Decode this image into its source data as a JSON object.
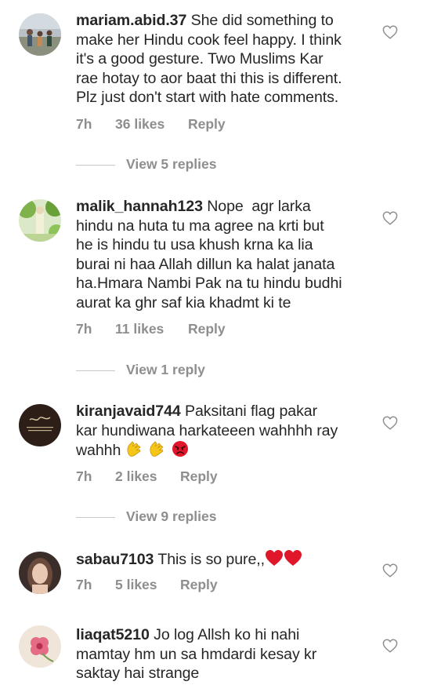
{
  "comments": [
    {
      "username": "mariam.abid.37",
      "text": "She did something to make her Hindu cook feel happy. I think it's a good gesture. Two Muslims Kar rae hotay to aor baat thi this is different. Plz just don't start with hate comments.",
      "lines": [
        "mariam.abid.37 She did something to",
        "make her Hindu cook feel happy. I think",
        "it's a good gesture. Two Muslims Kar",
        "rae hotay to aor baat thi this is different.",
        "Plz just don't start with hate comments."
      ],
      "time": "7h",
      "likes": "36 likes",
      "reply_label": "Reply",
      "view_replies": "View 5 replies",
      "avatar": "family-photo"
    },
    {
      "username": "malik_hannah123",
      "text": "Nope  agr larka hindu na huta tu ma agree na krti but he is hindu tu usa khush krna ka lia burai ni haa Allah dillun ka halat janata ha.Hmara Nambi Pak na tu hindu budhi aurat ka ghr saf kia khadmt ki te",
      "lines": [
        "malik_hannah123 Nope  agr larka",
        "hindu na huta tu ma agree na krti but",
        "he is hindu tu usa khush krna ka lia",
        "burai ni haa Allah dillun ka halat janata",
        "ha.Hmara Nambi Pak na tu hindu budhi",
        "aurat ka ghr saf kia khadmt ki te"
      ],
      "time": "7h",
      "likes": "11 likes",
      "reply_label": "Reply",
      "view_replies": "View 1 reply",
      "avatar": "garden-photo"
    },
    {
      "username": "kiranjavaid744",
      "text": "Paksitani flag pakar kar hundiwana harkateeen wahhhh ray wahhh",
      "lines": [
        "kiranjavaid744 Paksitani flag pakar",
        "kar hundiwana harkateeen wahhhh ray",
        "wahhh"
      ],
      "emojis": [
        "clapping-hands",
        "clapping-hands",
        "angry-face"
      ],
      "time": "7h",
      "likes": "2 likes",
      "reply_label": "Reply",
      "view_replies": "View 9 replies",
      "avatar": "calligraphy-dark"
    },
    {
      "username": "sabau7103",
      "text": "This is so pure,,",
      "lines": [
        "sabau7103 This is so pure,,"
      ],
      "emojis": [
        "red-heart",
        "red-heart"
      ],
      "time": "7h",
      "likes": "5 likes",
      "reply_label": "Reply",
      "avatar": "portrait-photo"
    },
    {
      "username": "liaqat5210",
      "text": "Jo log Allsh ko hi nahi mamtay hm un sa hmdardi kesay kr saktay hai strange",
      "lines": [
        "liaqat5210 Jo log Allsh ko hi nahi",
        "mamtay hm un sa hmdardi kesay kr",
        "saktay hai strange"
      ],
      "avatar": "flower-photo"
    }
  ],
  "colors": {
    "text": "#262626",
    "muted": "#8e8e8e",
    "divider": "#c7c7c7",
    "heart_emoji": "#e0162b",
    "angry_emoji": "#e0162b",
    "clap_emoji": "#f5c518"
  },
  "icons": {
    "like": "heart-outline-icon"
  }
}
